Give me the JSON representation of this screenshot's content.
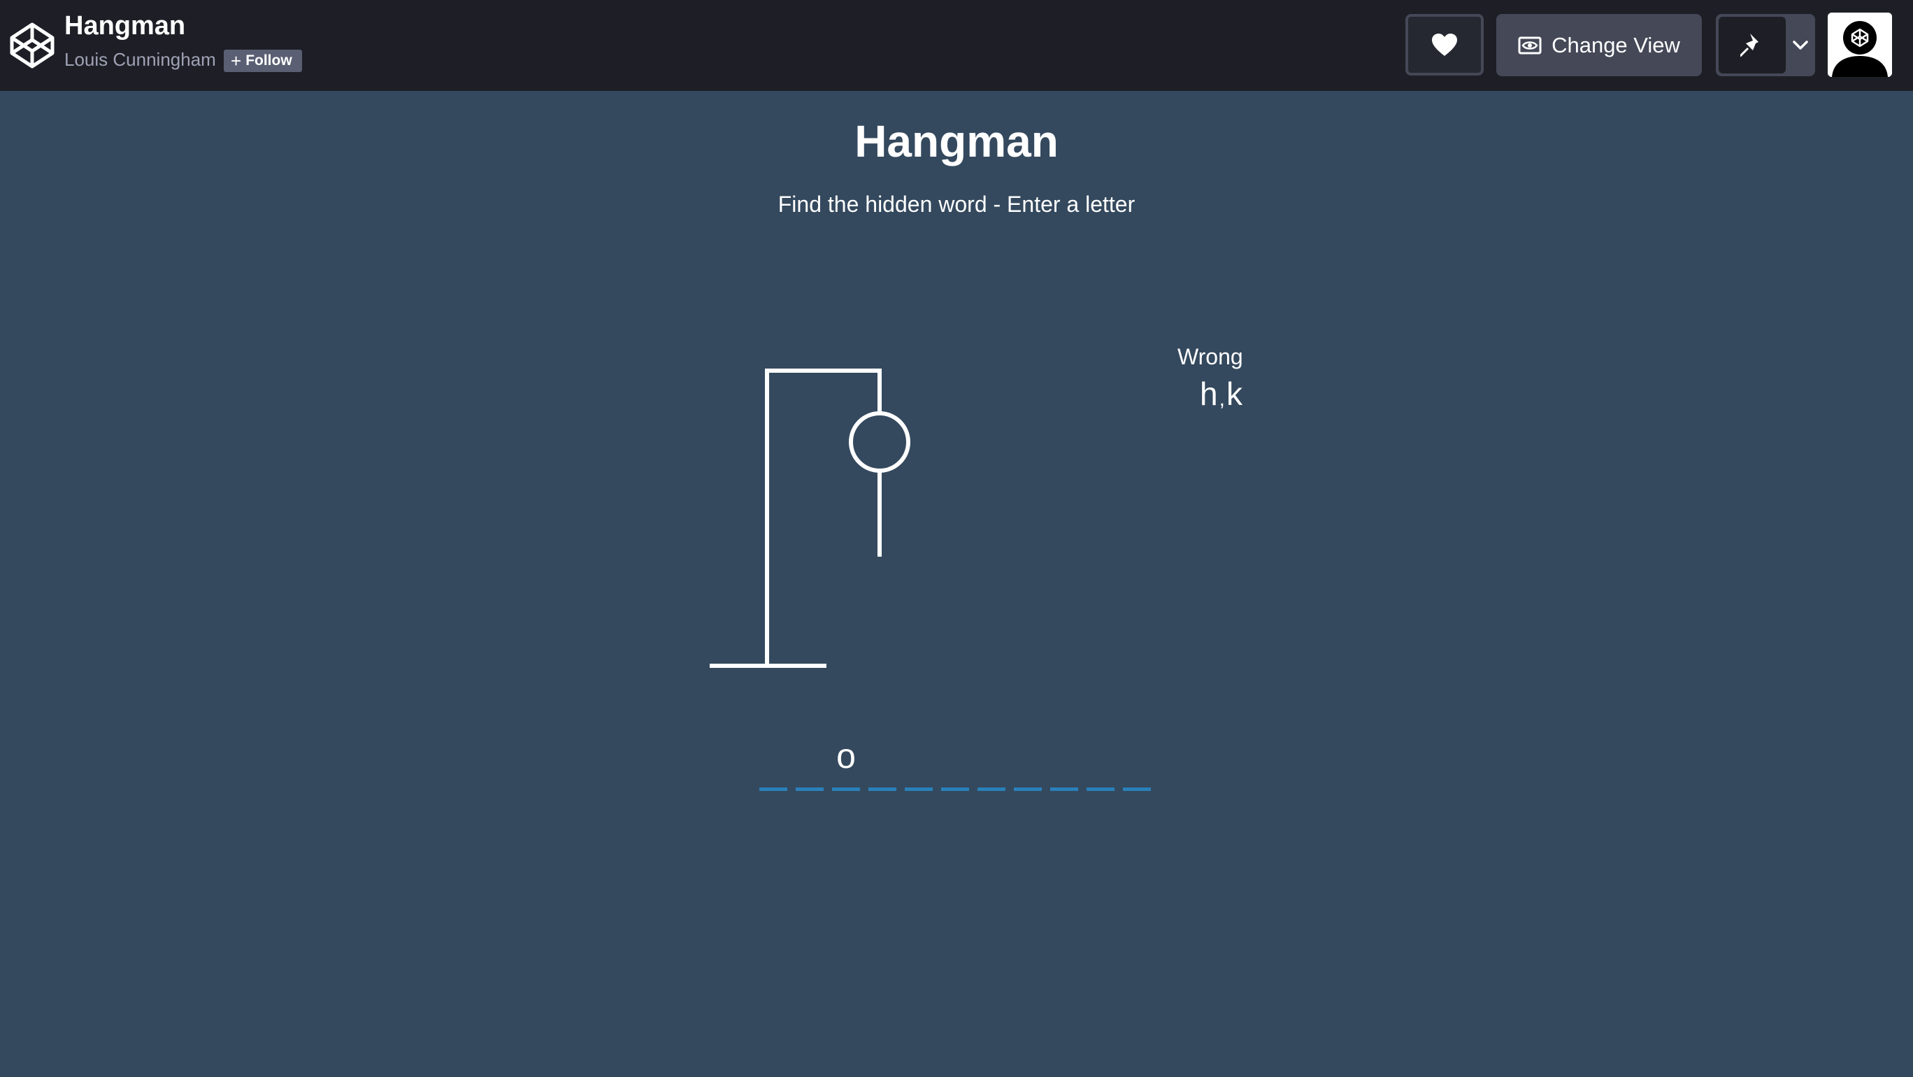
{
  "header": {
    "pen_title": "Hangman",
    "author": "Louis Cunningham",
    "follow_label": "Follow",
    "change_view_label": "Change View"
  },
  "game": {
    "title": "Hangman",
    "subtitle": "Find the hidden word - Enter a letter",
    "wrong_label": "Wrong",
    "wrong_letters": [
      "h",
      "k"
    ],
    "word_slots": [
      "",
      "",
      "o",
      "",
      "",
      "",
      "",
      "",
      "",
      "",
      ""
    ],
    "hangman_parts_shown": [
      "head",
      "body"
    ]
  },
  "colors": {
    "background": "#34495e",
    "topbar": "#1e1f26",
    "button": "#444857",
    "dash": "#2980b9",
    "text": "#ffffff"
  },
  "icons": [
    "codepen-logo-icon",
    "heart-icon",
    "eye-icon",
    "pin-icon",
    "chevron-down-icon",
    "avatar-icon"
  ]
}
